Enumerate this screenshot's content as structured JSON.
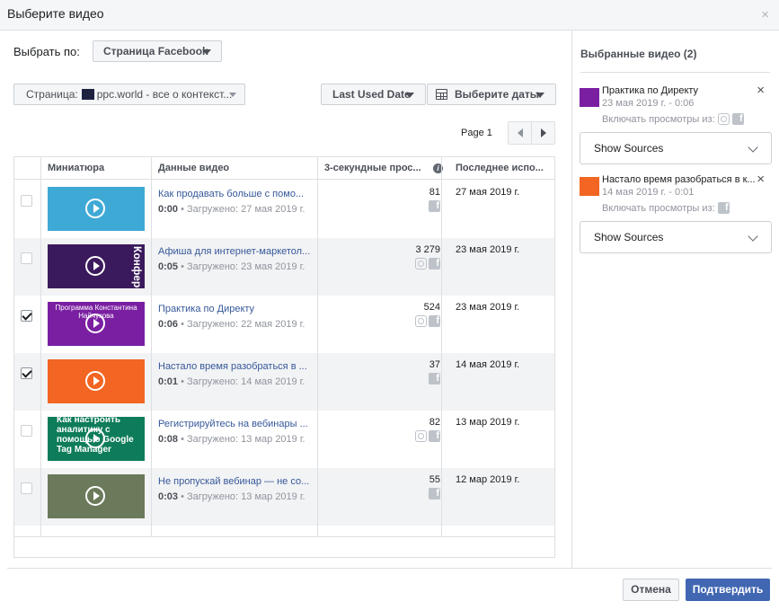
{
  "dialog": {
    "title": "Выберите видео",
    "close_icon": "×"
  },
  "toolbar": {
    "select_by_label": "Выбрать по:",
    "source_value": "Страница Facebook",
    "page_prefix": "Страница:",
    "page_name": "ppc.world - все о контекст...",
    "sort_value": "Last Used Date",
    "dates_label": "Выберите даты"
  },
  "pagination": {
    "label": "Page 1"
  },
  "table": {
    "columns": [
      "Миниатюра",
      "Данные видео",
      "3-секундные прос...",
      "Последнее испо..."
    ],
    "rows": [
      {
        "checked": false,
        "title": "Как продавать больше с помо...",
        "duration": "0:00",
        "uploaded": " • Загружено: 27 мая 2019 г.",
        "views": "81",
        "sources": [
          "facebook"
        ],
        "last_used": "27 мая 2019 г.",
        "thumb_color": "#3fa9d6"
      },
      {
        "checked": false,
        "title": "Афиша для интернет-маркетол...",
        "duration": "0:05",
        "uploaded": " • Загружено: 23 мая 2019 г.",
        "views": "3 279",
        "sources": [
          "instagram",
          "facebook"
        ],
        "last_used": "23 мая 2019 г.",
        "thumb_color": "#3a1a5c",
        "thumb_text": "Конференц"
      },
      {
        "checked": true,
        "title": "Практика по Директу",
        "duration": "0:06",
        "uploaded": " • Загружено: 22 мая 2019 г.",
        "views": "524",
        "sources": [
          "instagram",
          "facebook"
        ],
        "last_used": "23 мая 2019 г.",
        "thumb_color": "#7a1fa2",
        "thumb_text": "Программа Константина Найчукова"
      },
      {
        "checked": true,
        "title": "Настало время разобраться в ...",
        "duration": "0:01",
        "uploaded": " • Загружено: 14 мая 2019 г.",
        "views": "37",
        "sources": [
          "facebook"
        ],
        "last_used": "14 мая 2019 г.",
        "thumb_color": "#f26522"
      },
      {
        "checked": false,
        "title": "Регистрируйтесь на вебинары ...",
        "duration": "0:08",
        "uploaded": " • Загружено: 13 мар 2019 г.",
        "views": "82",
        "sources": [
          "instagram",
          "facebook"
        ],
        "last_used": "13 мар 2019 г.",
        "thumb_color": "#0e7c5a",
        "thumb_text": "Как настроить аналитику с помощью Google Tag Manager"
      },
      {
        "checked": false,
        "title": "Не пропускай вебинар — не со...",
        "duration": "0:03",
        "uploaded": " • Загружено: 13 мар 2019 г.",
        "views": "55",
        "sources": [
          "facebook"
        ],
        "last_used": "12 мар 2019 г.",
        "thumb_color": "#6b7a5a"
      }
    ]
  },
  "selected": {
    "header": "Выбранные видео (2)",
    "include_views_label": "Включать просмотры из:",
    "show_sources_label": "Show Sources",
    "items": [
      {
        "title": "Практика по Директу",
        "meta": "23 мая 2019 г. - 0:06",
        "sources": [
          "instagram",
          "facebook"
        ],
        "thumb_color": "#7a1fa2"
      },
      {
        "title": "Настало время разобраться в к...",
        "meta": "14 мая 2019 г. - 0:01",
        "sources": [
          "facebook"
        ],
        "thumb_color": "#f26522"
      }
    ]
  },
  "footer": {
    "cancel_label": "Отмена",
    "confirm_label": "Подтвердить"
  },
  "colors": {
    "accent": "#4267b2",
    "link": "#365899",
    "border": "#dddfe2"
  }
}
